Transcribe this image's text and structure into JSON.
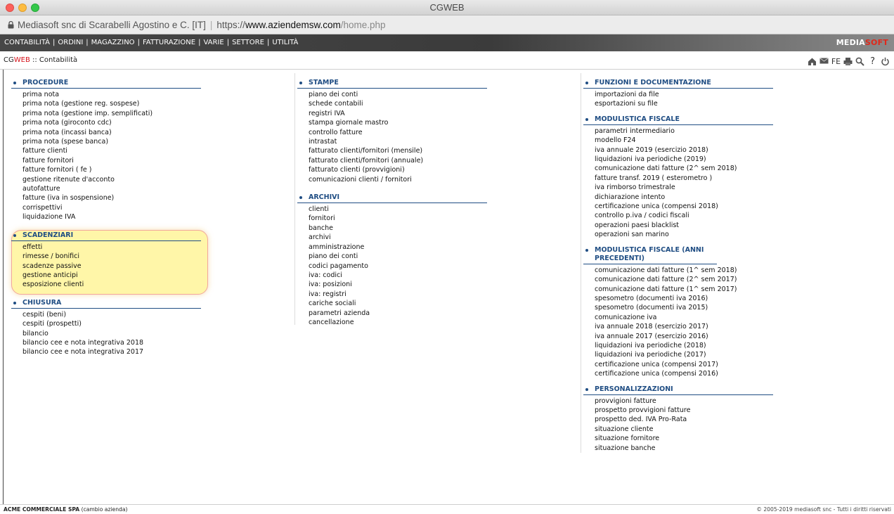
{
  "window": {
    "title": "CGWEB"
  },
  "address": {
    "site_name": "Mediasoft snc di Scarabelli Agostino e C. [IT]",
    "protocol": "https://",
    "domain": "www.aziendemsw.com",
    "path": "/home.php"
  },
  "menubar": {
    "items": [
      "CONTABILITÀ",
      "ORDINI",
      "MAGAZZINO",
      "FATTURAZIONE",
      "VARIE",
      "SETTORE",
      "UTILITÀ"
    ],
    "separator": "|",
    "brand_part1": "MEDIA",
    "brand_part2": "SOFT"
  },
  "breadcrumb": {
    "app": "CG",
    "app_accent": "WEB",
    "separator": " :: ",
    "page": "Contabilità"
  },
  "toolbar": {
    "fe_label": "FE",
    "help_label": "?"
  },
  "icons": [
    "home-icon",
    "mail-icon",
    "print-icon",
    "search-icon",
    "power-icon"
  ],
  "columns": [
    {
      "sections": [
        {
          "title": "PROCEDURE",
          "items": [
            "prima nota",
            "prima nota (gestione reg. sospese)",
            "prima nota (gestione imp. semplificati)",
            "prima nota (giroconto cdc)",
            "prima nota (incassi banca)",
            "prima nota (spese banca)",
            "fatture clienti",
            "fatture fornitori",
            "fatture fornitori ( fe )",
            "gestione ritenute d'acconto",
            "autofatture",
            "fatture (iva in sospensione)",
            "corrispettivi",
            "liquidazione IVA"
          ]
        },
        {
          "title": "SCADENZIARI",
          "items": [
            "effetti",
            "rimesse / bonifici",
            "scadenze passive",
            "gestione anticipi",
            "esposizione clienti"
          ]
        },
        {
          "title": "CHIUSURA",
          "items": [
            "cespiti (beni)",
            "cespiti (prospetti)",
            "bilancio",
            "bilancio cee e nota integrativa 2018",
            "bilancio cee e nota integrativa 2017"
          ]
        }
      ]
    },
    {
      "sections": [
        {
          "title": "STAMPE",
          "items": [
            "piano dei conti",
            "schede contabili",
            "registri IVA",
            "stampa giornale mastro",
            "controllo fatture",
            "intrastat",
            "fatturato clienti/fornitori (mensile)",
            "fatturato clienti/fornitori (annuale)",
            "fatturato clienti (provvigioni)",
            "comunicazioni clienti / fornitori"
          ]
        },
        {
          "title": "ARCHIVI",
          "items": [
            "clienti",
            "fornitori",
            "banche",
            "archivi",
            "amministrazione",
            "piano dei conti",
            "codici pagamento",
            "iva: codici",
            "iva: posizioni",
            "iva: registri",
            "cariche sociali",
            "parametri azienda",
            "cancellazione"
          ]
        }
      ]
    },
    {
      "sections": [
        {
          "title": "FUNZIONI E DOCUMENTAZIONE",
          "items": [
            "importazioni da file",
            "esportazioni su file"
          ]
        },
        {
          "title": "MODULISTICA FISCALE",
          "items": [
            "parametri intermediario",
            "modello F24",
            "iva annuale 2019 (esercizio 2018)",
            "liquidazioni iva periodiche (2019)",
            "comunicazione dati fatture (2^ sem 2018)",
            "fatture transf. 2019 ( esterometro )",
            "iva rimborso trimestrale",
            "dichiarazione intento",
            "certificazione unica (compensi 2018)",
            "controllo p.iva / codici fiscali",
            "operazioni paesi blacklist",
            "operazioni san marino"
          ]
        },
        {
          "title": "MODULISTICA FISCALE (ANNI PRECEDENTI)",
          "items": [
            "comunicazione dati fatture (1^ sem 2018)",
            "comunicazione dati fatture (2^ sem 2017)",
            "comunicazione dati fatture (1^ sem 2017)",
            "spesometro (documenti iva 2016)",
            "spesometro (documenti iva 2015)",
            "comunicazione iva",
            "iva annuale 2018 (esercizio 2017)",
            "iva annuale 2017 (esercizio 2016)",
            "liquidazioni iva periodiche (2018)",
            "liquidazioni iva periodiche (2017)",
            "certificazione unica (compensi 2017)",
            "certificazione unica (compensi 2016)"
          ]
        },
        {
          "title": "PERSONALIZZAZIONI",
          "items": [
            "provvigioni fatture",
            "prospetto provvigioni fatture",
            "prospetto ded. IVA Pro-Rata",
            "situazione cliente",
            "situazione fornitore",
            "situazione banche"
          ]
        }
      ]
    }
  ],
  "footer": {
    "company": "ACME COMMERCIALE SPA",
    "change_label": "(cambio azienda)",
    "copyright": "© 2005-2019 mediasoft snc - Tutti i diritti riservati"
  }
}
